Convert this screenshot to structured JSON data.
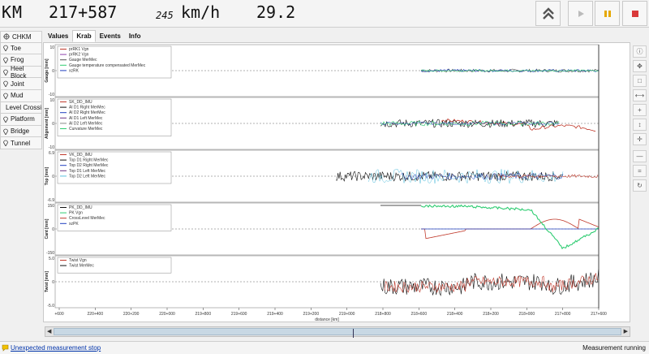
{
  "header": {
    "km_label": "KM",
    "km_value": "217+587",
    "km_sub": "245",
    "speed_unit": "km/h",
    "speed_value": "29.2"
  },
  "toolbar": {
    "buttons": [
      "collapse-up-icon",
      "play-icon",
      "pause-icon",
      "stop-icon"
    ]
  },
  "sidebar": {
    "items": [
      {
        "label": "CHKM",
        "icon": "crosshair-icon"
      },
      {
        "label": "Toe",
        "icon": "pin-icon"
      },
      {
        "label": "Frog",
        "icon": "pin-icon"
      },
      {
        "label": "Heel Block",
        "icon": "pin-icon"
      },
      {
        "label": "Joint",
        "icon": "pin-icon"
      },
      {
        "label": "Mud",
        "icon": "pin-icon"
      },
      {
        "label": "Level Crossing",
        "icon": "pin-icon"
      },
      {
        "label": "Platform",
        "icon": "pin-icon"
      },
      {
        "label": "Bridge",
        "icon": "pin-icon"
      },
      {
        "label": "Tunnel",
        "icon": "pin-icon"
      }
    ]
  },
  "tabs": [
    {
      "label": "Values",
      "active": false
    },
    {
      "label": "Krab",
      "active": true
    },
    {
      "label": "Events",
      "active": false
    },
    {
      "label": "Info",
      "active": false
    }
  ],
  "chart_data": [
    {
      "type": "line",
      "ylabel": "Gauge [mm]",
      "ylim": [
        -10,
        10
      ],
      "yticks": [
        "10",
        "0",
        "-10"
      ],
      "series": [
        {
          "name": "prRK1 Vgn",
          "color": "#c0392b"
        },
        {
          "name": "prRK2 Vgn",
          "color": "#8e44ad"
        },
        {
          "name": "Gauge MerMec",
          "color": "#555555"
        },
        {
          "name": "Gauge temperature compensated MerMec",
          "color": "#2ecc71"
        },
        {
          "name": "xzRK",
          "color": "#1f3fbf"
        }
      ]
    },
    {
      "type": "line",
      "ylabel": "Alignment [mm]",
      "ylim": [
        -10,
        10
      ],
      "yticks": [
        "10",
        "0",
        "-10"
      ],
      "series": [
        {
          "name": "SK_DD_IMU",
          "color": "#c0392b"
        },
        {
          "name": "Al D1 Right MerMec",
          "color": "#111111"
        },
        {
          "name": "Al D2 Right MerMec",
          "color": "#1f3fbf"
        },
        {
          "name": "Al D1 Left MerMec",
          "color": "#6c3483"
        },
        {
          "name": "Al D2 Left MerMec",
          "color": "#888888"
        },
        {
          "name": "Curvature MerMec",
          "color": "#2ecc71"
        }
      ]
    },
    {
      "type": "line",
      "ylabel": "Top [mm]",
      "ylim": [
        -6.9,
        6.9
      ],
      "yticks": [
        "6.9",
        "0",
        "-6.9"
      ],
      "series": [
        {
          "name": "VK_DD_IMU",
          "color": "#c0392b"
        },
        {
          "name": "Top D1 Right MerMec",
          "color": "#111111"
        },
        {
          "name": "Top D2 Right MerMec",
          "color": "#1f3fbf"
        },
        {
          "name": "Top D1 Left MerMec",
          "color": "#6c3483"
        },
        {
          "name": "Top D2 Left MerMec",
          "color": "#5bc0de"
        }
      ]
    },
    {
      "type": "line",
      "ylabel": "Cant [mm]",
      "ylim": [
        -150,
        150
      ],
      "yticks": [
        "150",
        "0",
        "-150"
      ],
      "series": [
        {
          "name": "PK_DD_IMU",
          "color": "#111111"
        },
        {
          "name": "PK Vgn",
          "color": "#2ecc71"
        },
        {
          "name": "CrossLevel MerMec",
          "color": "#c0392b"
        },
        {
          "name": "xzPK",
          "color": "#1f3fbf"
        }
      ]
    },
    {
      "type": "line",
      "ylabel": "Twist [mm]",
      "ylim": [
        -5.0,
        5.0
      ],
      "yticks": [
        "5.0",
        "0",
        "-5.0"
      ],
      "series": [
        {
          "name": "Twist Vgn",
          "color": "#c0392b"
        },
        {
          "name": "Twist MerMec",
          "color": "#111111"
        }
      ]
    }
  ],
  "x_axis": {
    "xlabel": "distance [km]",
    "ticks": [
      "+600",
      "220+400",
      "220+200",
      "220+000",
      "219+800",
      "219+600",
      "219+400",
      "219+200",
      "219+000",
      "218+800",
      "218+600",
      "218+400",
      "218+200",
      "218+000",
      "217+800",
      "217+600"
    ]
  },
  "right_tools": [
    "info-icon",
    "pan-icon",
    "zoom-box-icon",
    "fit-horizontal-icon",
    "zoom-in-icon",
    "fit-vertical-icon",
    "cursor-icon",
    "collapse-icon",
    "expand-icon",
    "reset-icon"
  ],
  "status": {
    "left": "Unexpected measurement stop",
    "right": "Measurement running"
  }
}
